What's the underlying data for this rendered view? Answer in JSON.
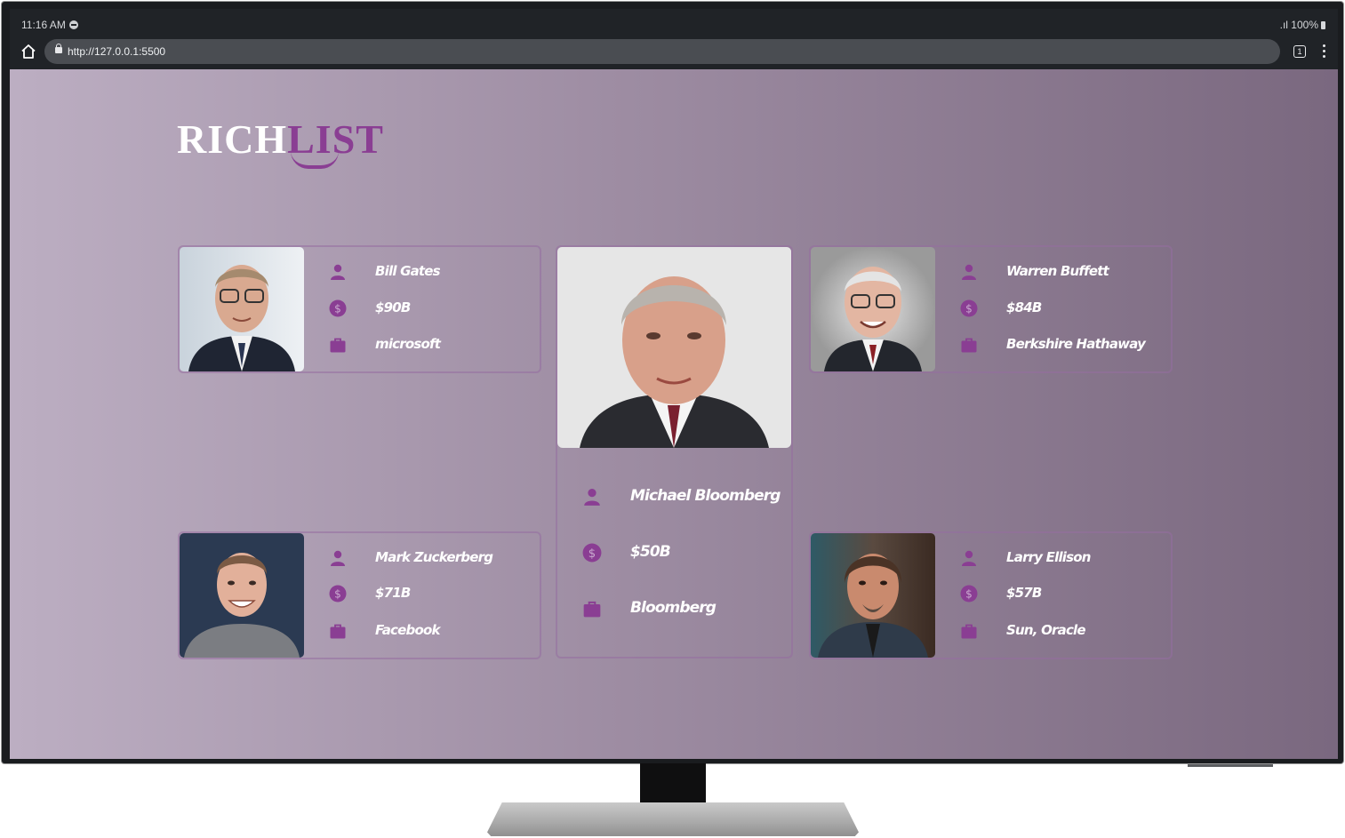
{
  "status_bar": {
    "time": "11:16 AM",
    "signal_battery": ".ıl 100%"
  },
  "browser": {
    "url": "http://127.0.0.1:5500",
    "tab_count": "1"
  },
  "logo": {
    "part1": "RICH",
    "part2": "LIST"
  },
  "accent_color": "#8a3e93",
  "cards": [
    {
      "name": "Bill Gates",
      "worth": "$90B",
      "company": "microsoft"
    },
    {
      "name": "Warren Buffett",
      "worth": "$84B",
      "company": "Berkshire Hathaway"
    },
    {
      "name": "Mark Zuckerberg",
      "worth": "$71B",
      "company": "Facebook"
    },
    {
      "name": "Larry Ellison",
      "worth": "$57B",
      "company": "Sun, Oracle"
    }
  ],
  "featured": {
    "name": "Michael Bloomberg",
    "worth": "$50B",
    "company": "Bloomberg"
  },
  "icons": {
    "name": "person-icon",
    "worth": "dollar-icon",
    "company": "briefcase-icon"
  }
}
